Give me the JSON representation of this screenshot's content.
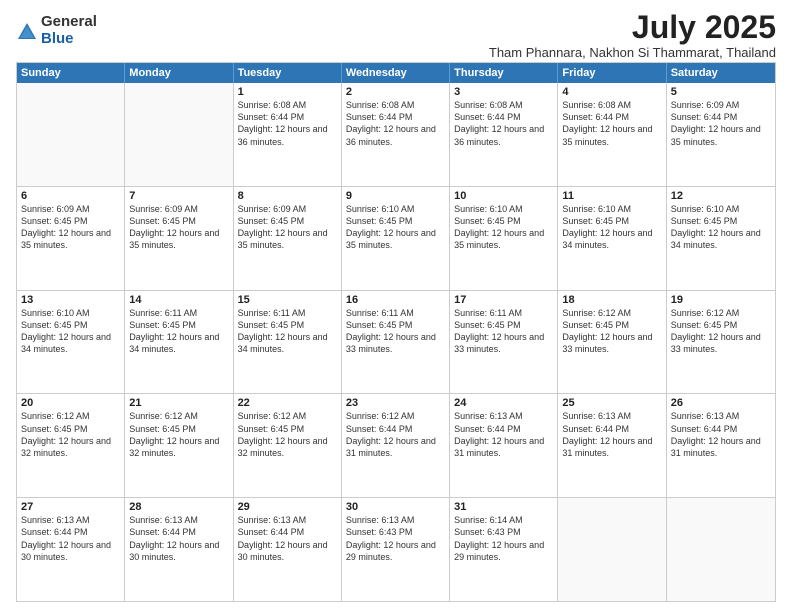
{
  "logo": {
    "general": "General",
    "blue": "Blue"
  },
  "title": "July 2025",
  "location": "Tham Phannara, Nakhon Si Thammarat, Thailand",
  "header": {
    "days": [
      "Sunday",
      "Monday",
      "Tuesday",
      "Wednesday",
      "Thursday",
      "Friday",
      "Saturday"
    ]
  },
  "rows": [
    [
      {
        "day": "",
        "empty": true
      },
      {
        "day": "",
        "empty": true
      },
      {
        "day": "1",
        "sunrise": "6:08 AM",
        "sunset": "6:44 PM",
        "daylight": "12 hours and 36 minutes."
      },
      {
        "day": "2",
        "sunrise": "6:08 AM",
        "sunset": "6:44 PM",
        "daylight": "12 hours and 36 minutes."
      },
      {
        "day": "3",
        "sunrise": "6:08 AM",
        "sunset": "6:44 PM",
        "daylight": "12 hours and 36 minutes."
      },
      {
        "day": "4",
        "sunrise": "6:08 AM",
        "sunset": "6:44 PM",
        "daylight": "12 hours and 35 minutes."
      },
      {
        "day": "5",
        "sunrise": "6:09 AM",
        "sunset": "6:44 PM",
        "daylight": "12 hours and 35 minutes."
      }
    ],
    [
      {
        "day": "6",
        "sunrise": "6:09 AM",
        "sunset": "6:45 PM",
        "daylight": "12 hours and 35 minutes."
      },
      {
        "day": "7",
        "sunrise": "6:09 AM",
        "sunset": "6:45 PM",
        "daylight": "12 hours and 35 minutes."
      },
      {
        "day": "8",
        "sunrise": "6:09 AM",
        "sunset": "6:45 PM",
        "daylight": "12 hours and 35 minutes."
      },
      {
        "day": "9",
        "sunrise": "6:10 AM",
        "sunset": "6:45 PM",
        "daylight": "12 hours and 35 minutes."
      },
      {
        "day": "10",
        "sunrise": "6:10 AM",
        "sunset": "6:45 PM",
        "daylight": "12 hours and 35 minutes."
      },
      {
        "day": "11",
        "sunrise": "6:10 AM",
        "sunset": "6:45 PM",
        "daylight": "12 hours and 34 minutes."
      },
      {
        "day": "12",
        "sunrise": "6:10 AM",
        "sunset": "6:45 PM",
        "daylight": "12 hours and 34 minutes."
      }
    ],
    [
      {
        "day": "13",
        "sunrise": "6:10 AM",
        "sunset": "6:45 PM",
        "daylight": "12 hours and 34 minutes."
      },
      {
        "day": "14",
        "sunrise": "6:11 AM",
        "sunset": "6:45 PM",
        "daylight": "12 hours and 34 minutes."
      },
      {
        "day": "15",
        "sunrise": "6:11 AM",
        "sunset": "6:45 PM",
        "daylight": "12 hours and 34 minutes."
      },
      {
        "day": "16",
        "sunrise": "6:11 AM",
        "sunset": "6:45 PM",
        "daylight": "12 hours and 33 minutes."
      },
      {
        "day": "17",
        "sunrise": "6:11 AM",
        "sunset": "6:45 PM",
        "daylight": "12 hours and 33 minutes."
      },
      {
        "day": "18",
        "sunrise": "6:12 AM",
        "sunset": "6:45 PM",
        "daylight": "12 hours and 33 minutes."
      },
      {
        "day": "19",
        "sunrise": "6:12 AM",
        "sunset": "6:45 PM",
        "daylight": "12 hours and 33 minutes."
      }
    ],
    [
      {
        "day": "20",
        "sunrise": "6:12 AM",
        "sunset": "6:45 PM",
        "daylight": "12 hours and 32 minutes."
      },
      {
        "day": "21",
        "sunrise": "6:12 AM",
        "sunset": "6:45 PM",
        "daylight": "12 hours and 32 minutes."
      },
      {
        "day": "22",
        "sunrise": "6:12 AM",
        "sunset": "6:45 PM",
        "daylight": "12 hours and 32 minutes."
      },
      {
        "day": "23",
        "sunrise": "6:12 AM",
        "sunset": "6:44 PM",
        "daylight": "12 hours and 31 minutes."
      },
      {
        "day": "24",
        "sunrise": "6:13 AM",
        "sunset": "6:44 PM",
        "daylight": "12 hours and 31 minutes."
      },
      {
        "day": "25",
        "sunrise": "6:13 AM",
        "sunset": "6:44 PM",
        "daylight": "12 hours and 31 minutes."
      },
      {
        "day": "26",
        "sunrise": "6:13 AM",
        "sunset": "6:44 PM",
        "daylight": "12 hours and 31 minutes."
      }
    ],
    [
      {
        "day": "27",
        "sunrise": "6:13 AM",
        "sunset": "6:44 PM",
        "daylight": "12 hours and 30 minutes."
      },
      {
        "day": "28",
        "sunrise": "6:13 AM",
        "sunset": "6:44 PM",
        "daylight": "12 hours and 30 minutes."
      },
      {
        "day": "29",
        "sunrise": "6:13 AM",
        "sunset": "6:44 PM",
        "daylight": "12 hours and 30 minutes."
      },
      {
        "day": "30",
        "sunrise": "6:13 AM",
        "sunset": "6:43 PM",
        "daylight": "12 hours and 29 minutes."
      },
      {
        "day": "31",
        "sunrise": "6:14 AM",
        "sunset": "6:43 PM",
        "daylight": "12 hours and 29 minutes."
      },
      {
        "day": "",
        "empty": true
      },
      {
        "day": "",
        "empty": true
      }
    ]
  ]
}
